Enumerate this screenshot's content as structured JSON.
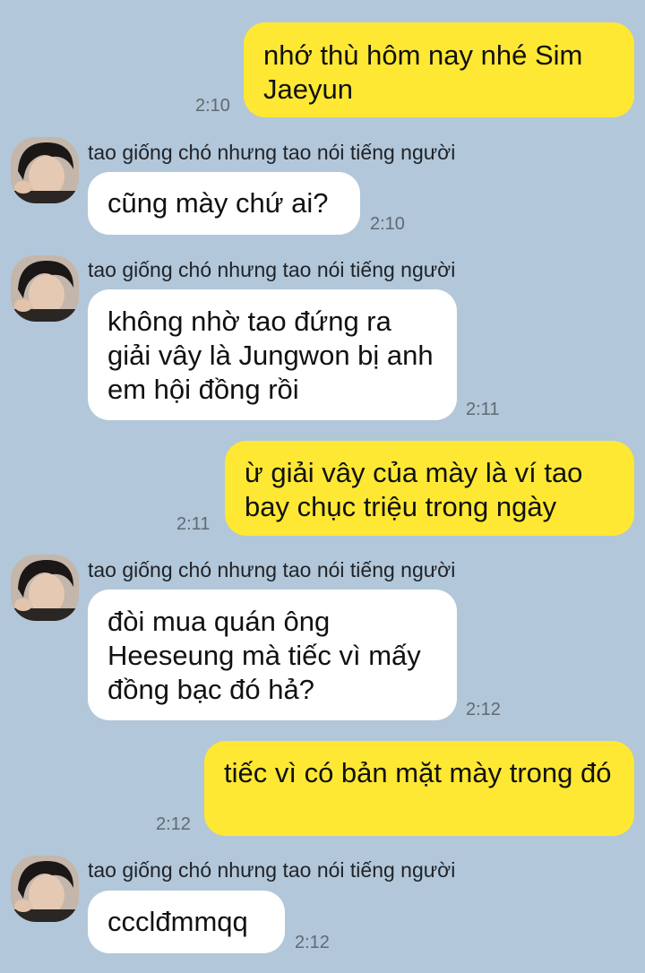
{
  "sender_name": "tao giống chó nhưng tao nói tiếng người",
  "avatar_icon": "profile-photo-avatar",
  "colors": {
    "background": "#b2c7d9",
    "my_bubble": "#fee833",
    "their_bubble": "#ffffff",
    "time": "#606a73"
  },
  "messages": [
    {
      "from": "me",
      "text": "nhớ thù hôm nay nhé Sim Jaeyun",
      "time": "2:10"
    },
    {
      "from": "other",
      "text": "cũng mày chứ ai?",
      "time": "2:10"
    },
    {
      "from": "other",
      "text": "không nhờ tao đứng ra giải vây là Jungwon bị anh em hội đồng rồi",
      "time": "2:11"
    },
    {
      "from": "me",
      "text": "ừ giải vây của mày là ví tao bay chục triệu trong ngày",
      "time": "2:11"
    },
    {
      "from": "other",
      "text": "đòi mua quán ông Heeseung mà tiếc vì mấy đồng bạc đó hả?",
      "time": "2:12"
    },
    {
      "from": "me",
      "text": "tiếc vì có bản mặt mày trong đó",
      "time": "2:12"
    },
    {
      "from": "other",
      "text": "ccclđmmqq",
      "time": "2:12"
    }
  ]
}
